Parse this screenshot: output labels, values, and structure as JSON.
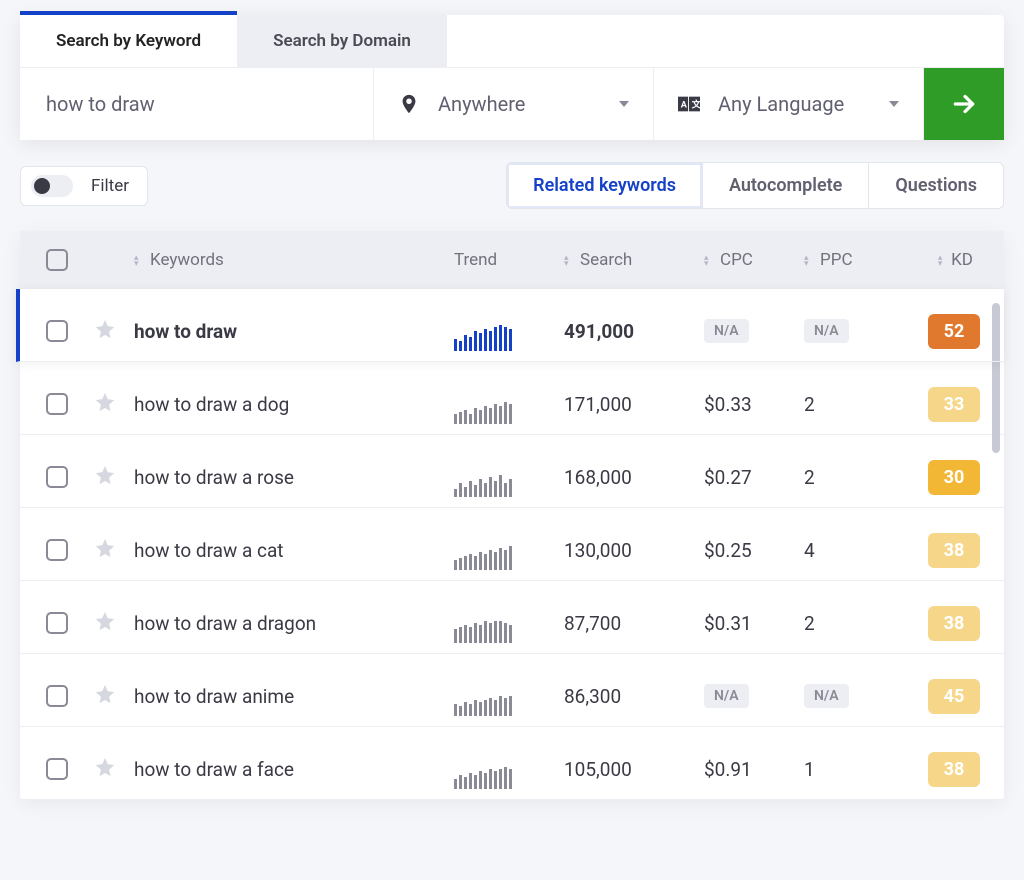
{
  "tabs": {
    "keyword": "Search by Keyword",
    "domain": "Search by Domain"
  },
  "search": {
    "value": "how to draw",
    "location": "Anywhere",
    "language": "Any Language"
  },
  "filter_label": "Filter",
  "segments": {
    "related": "Related keywords",
    "autocomplete": "Autocomplete",
    "questions": "Questions"
  },
  "columns": {
    "keywords": "Keywords",
    "trend": "Trend",
    "search": "Search",
    "cpc": "CPC",
    "ppc": "PPC",
    "kd": "KD"
  },
  "rows": [
    {
      "kw": "how to draw",
      "search": "491,000",
      "cpc": "N/A",
      "ppc": "N/A",
      "kd": "52",
      "kd_color": "#e0792d",
      "active": true,
      "bars": [
        12,
        10,
        16,
        14,
        20,
        18,
        22,
        20,
        24,
        26,
        24,
        22
      ]
    },
    {
      "kw": "how to draw a dog",
      "search": "171,000",
      "cpc": "$0.33",
      "ppc": "2",
      "kd": "33",
      "kd_color": "#f6d78a",
      "active": false,
      "bars": [
        10,
        12,
        14,
        10,
        16,
        14,
        18,
        16,
        20,
        18,
        22,
        20
      ]
    },
    {
      "kw": "how to draw a rose",
      "search": "168,000",
      "cpc": "$0.27",
      "ppc": "2",
      "kd": "30",
      "kd_color": "#f3b736",
      "active": false,
      "bars": [
        8,
        14,
        10,
        16,
        12,
        18,
        14,
        20,
        16,
        22,
        14,
        18
      ]
    },
    {
      "kw": "how to draw a cat",
      "search": "130,000",
      "cpc": "$0.25",
      "ppc": "4",
      "kd": "38",
      "kd_color": "#f6d78a",
      "active": false,
      "bars": [
        10,
        12,
        14,
        16,
        14,
        18,
        16,
        20,
        18,
        22,
        20,
        24
      ]
    },
    {
      "kw": "how to draw a dragon",
      "search": "87,700",
      "cpc": "$0.31",
      "ppc": "2",
      "kd": "38",
      "kd_color": "#f6d78a",
      "active": false,
      "bars": [
        14,
        16,
        18,
        16,
        20,
        18,
        22,
        20,
        22,
        22,
        20,
        18
      ]
    },
    {
      "kw": "how to draw anime",
      "search": "86,300",
      "cpc": "N/A",
      "ppc": "N/A",
      "kd": "45",
      "kd_color": "#f6d78a",
      "active": false,
      "bars": [
        12,
        10,
        14,
        12,
        16,
        14,
        16,
        18,
        16,
        20,
        18,
        20
      ]
    },
    {
      "kw": "how to draw a face",
      "search": "105,000",
      "cpc": "$0.91",
      "ppc": "1",
      "kd": "38",
      "kd_color": "#f6d78a",
      "active": false,
      "bars": [
        10,
        14,
        12,
        16,
        14,
        18,
        16,
        20,
        18,
        20,
        22,
        20
      ]
    }
  ]
}
